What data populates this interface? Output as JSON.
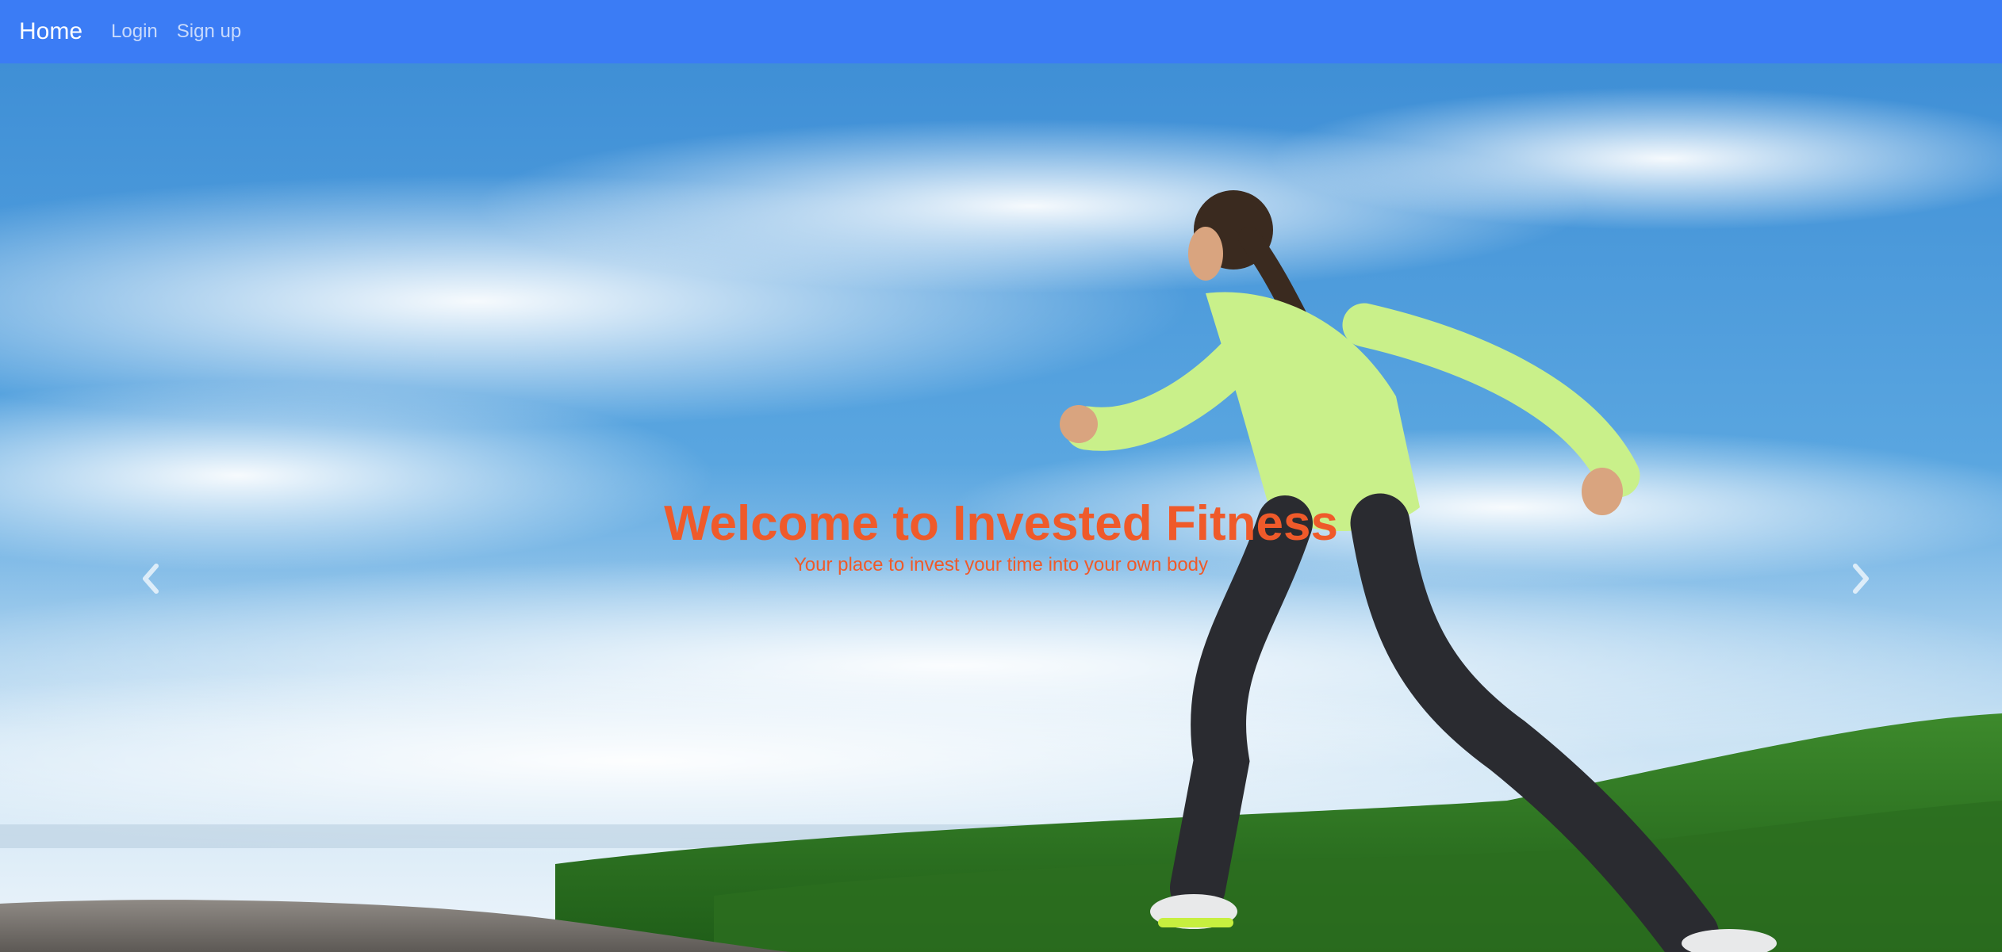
{
  "navbar": {
    "brand": "Home",
    "links": [
      "Login",
      "Sign up"
    ],
    "background": "#3b7cf5"
  },
  "hero": {
    "title": "Welcome to Invested Fitness",
    "subtitle": "Your place to invest your time into your own body",
    "title_color": "#ef5a2a",
    "image_subject": "woman running on a hilltop under a blue sky",
    "controls": {
      "prev_icon": "chevron-left-icon",
      "next_icon": "chevron-right-icon"
    }
  }
}
